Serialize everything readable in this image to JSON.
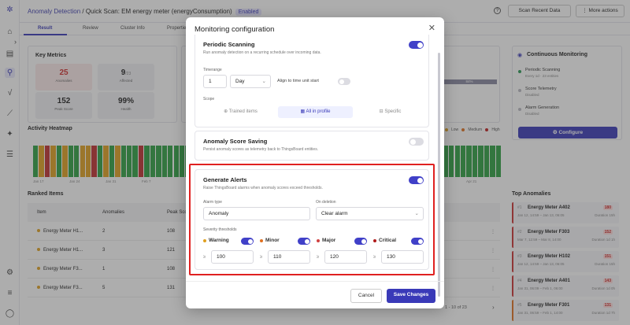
{
  "topbar": {
    "breadcrumb_link": "Anomaly Detection",
    "breadcrumb_rest": " / Quick Scan: EM energy meter (energyConsumption)",
    "status": "Enabled",
    "scan_button": "Scan Recent Data",
    "more_button": "More actions"
  },
  "tabs": [
    "Result",
    "Review",
    "Cluster Info",
    "Properties"
  ],
  "key_metrics": {
    "title": "Key Metrics",
    "items": [
      {
        "value": "25",
        "label": "Anomalies",
        "color": "#d03030",
        "bg": "#fbeaea"
      },
      {
        "value": "9",
        "suffix": "/23",
        "label": "Affected",
        "color": "#222",
        "bg": "#f1f1f4"
      },
      {
        "value": "152",
        "label": "Peak Score",
        "color": "#222",
        "bg": "#f1f1f4"
      },
      {
        "value": "99%",
        "label": "Health",
        "color": "#222",
        "bg": "#f1f1f4"
      }
    ]
  },
  "continuous": {
    "title": "Continuous Monitoring",
    "items": [
      {
        "name": "Periodic Scanning",
        "sub": "Every 1d · 23 entities",
        "color": "#2a9a55"
      },
      {
        "name": "Score Telemetry",
        "sub": "Disabled",
        "color": "#bbbbc4"
      },
      {
        "name": "Alarm Generation",
        "sub": "Disabled",
        "color": "#bbbbc4"
      }
    ],
    "configure": "Configure"
  },
  "heatmap": {
    "title": "Activity Heatmap",
    "legend": [
      "Low",
      "Medium",
      "High"
    ],
    "legend_colors": [
      "#e0a020",
      "#e07020",
      "#c02020"
    ],
    "pct_label": "84%",
    "dates": [
      "Jan 17",
      "Jan 24",
      "Jan 31",
      "Feb 7",
      "Apr 21"
    ]
  },
  "ranked": {
    "title": "Ranked Items",
    "headers": [
      "Item",
      "Anomalies",
      "Peak Score"
    ],
    "rows": [
      {
        "item": "Energy Meter H1...",
        "anomalies": "2",
        "peak": "108"
      },
      {
        "item": "Energy Meter H1...",
        "anomalies": "3",
        "peak": "121"
      },
      {
        "item": "Energy Meter F3...",
        "anomalies": "1",
        "peak": "108"
      },
      {
        "item": "Energy Meter F3...",
        "anomalies": "5",
        "peak": "131"
      }
    ],
    "pager": "1 - 10 of 23"
  },
  "top_anomalies": {
    "title": "Top Anomalies",
    "items": [
      {
        "rank": "#1",
        "name": "Energy Meter A402",
        "score": "180",
        "time": "Jan 12, 14:59 – Jan 13, 06:05",
        "dur": "Duration 15h"
      },
      {
        "rank": "#2",
        "name": "Energy Meter F303",
        "score": "152",
        "time": "Mar 7, 12:59 – Mar 8, 14:00",
        "dur": "Duration 1d 1h"
      },
      {
        "rank": "#3",
        "name": "Energy Meter H102",
        "score": "151",
        "time": "Jan 12, 14:59 – Jan 13, 06:05",
        "dur": "Duration 15h"
      },
      {
        "rank": "#4",
        "name": "Energy Meter A401",
        "score": "143",
        "time": "Jan 31, 06:09 – Feb 1, 06:00",
        "dur": "Duration 1d 0h"
      },
      {
        "rank": "#5",
        "name": "Energy Meter F301",
        "score": "131",
        "time": "Jan 31, 06:59 – Feb 1, 14:00",
        "dur": "Duration 1d 7h"
      }
    ]
  },
  "modal": {
    "title": "Monitoring configuration",
    "periodic": {
      "title": "Periodic Scanning",
      "desc": "Run anomaly detection on a recurring schedule over incoming data.",
      "timerange_label": "Timerange",
      "timerange_value": "1",
      "unit": "Day",
      "align": "Align to time unit start",
      "scope_label": "Scope",
      "scope_options": [
        "Trained items",
        "All in profile",
        "Specific"
      ]
    },
    "saving": {
      "title": "Anomaly Score Saving",
      "desc": "Persist anomaly scores as telemetry back to ThingsBoard entities."
    },
    "alerts": {
      "title": "Generate Alerts",
      "desc": "Raise ThingsBoard alarms when anomaly scores exceed thresholds.",
      "alarm_type_label": "Alarm type",
      "alarm_type_value": "Anomaly",
      "on_deletion_label": "On deletion",
      "on_deletion_value": "Clear alarm",
      "severity_label": "Severity thresholds",
      "severities": [
        {
          "name": "Warning",
          "value": "100",
          "color": "#e0a020"
        },
        {
          "name": "Minor",
          "value": "110",
          "color": "#e07020"
        },
        {
          "name": "Major",
          "value": "120",
          "color": "#d04040"
        },
        {
          "name": "Critical",
          "value": "130",
          "color": "#b01a1a"
        }
      ],
      "ge_symbol": "≥"
    },
    "cancel": "Cancel",
    "save": "Save Changes"
  }
}
